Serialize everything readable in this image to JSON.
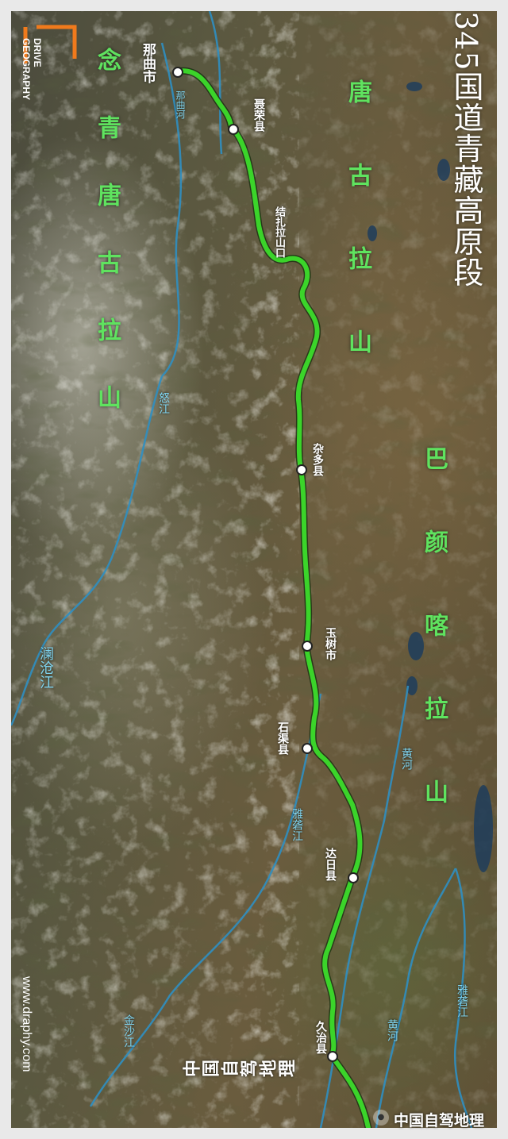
{
  "title": "345国道青藏高原段",
  "logo": {
    "text": "DRIVE\nGEOGRAPHY"
  },
  "website": "www.draphy.com",
  "brand": {
    "vertical": "中国自驾地理",
    "bottom": "中国自驾地理"
  },
  "colors": {
    "route": "#3bd42a",
    "river": "#2f8fc2",
    "mountain_label": "#5fe35f",
    "river_label": "#7fd4ef"
  },
  "cities": [
    {
      "name": "那曲市"
    },
    {
      "name": "聂荣县"
    },
    {
      "name": "杂多县"
    },
    {
      "name": "玉树市"
    },
    {
      "name": "石渠县"
    },
    {
      "name": "达日县"
    },
    {
      "name": "久治县"
    }
  ],
  "pass": {
    "name": "结扎拉山口"
  },
  "rivers": [
    "那曲河",
    "怒江",
    "澜沧江",
    "雅砻江",
    "金沙江",
    "黄河",
    "黄河",
    "雅砻江",
    "黄河"
  ],
  "mountains": [
    {
      "name": "念青唐古拉山"
    },
    {
      "name": "唐古拉山"
    },
    {
      "name": "巴颜喀拉山"
    }
  ]
}
